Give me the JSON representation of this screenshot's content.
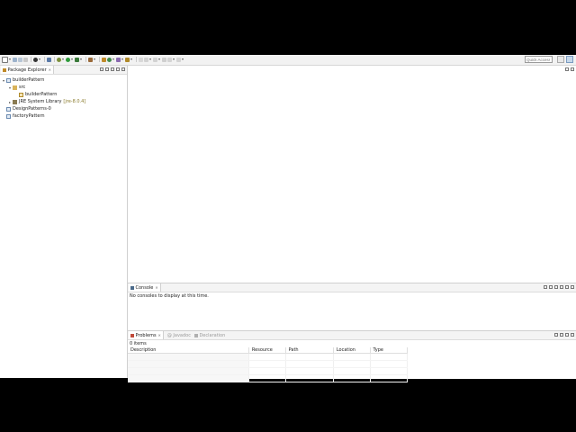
{
  "toolbar": {
    "quick_access_placeholder": "Quick Access",
    "icons": [
      "new-icon",
      "save-icon",
      "print-icon",
      "debug-icon",
      "run-icon",
      "external-tools-icon",
      "new-java-project-icon",
      "new-package-icon",
      "new-class-icon",
      "open-type-icon",
      "search-icon",
      "next-annotation-icon",
      "prev-annotation-icon",
      "back-icon",
      "forward-icon"
    ]
  },
  "package_explorer": {
    "tab_label": "Package Explorer",
    "tree": [
      {
        "label": "builderPattern",
        "level": 0,
        "expanded": true,
        "icon": "java-project-icon"
      },
      {
        "label": "src",
        "level": 1,
        "expanded": true,
        "icon": "source-folder-icon"
      },
      {
        "label": "builderPattern",
        "level": 2,
        "icon": "package-icon"
      },
      {
        "label": "JRE System Library",
        "suffix": "[jre-8.0.4]",
        "level": 1,
        "expanded": false,
        "icon": "library-icon"
      },
      {
        "label": "DesignPatterns-0",
        "level": 0,
        "icon": "java-project-icon"
      },
      {
        "label": "factoryPattern",
        "level": 0,
        "icon": "java-project-icon"
      }
    ]
  },
  "console": {
    "tab_label": "Console",
    "message": "No consoles to display at this time."
  },
  "problems": {
    "tabs": {
      "problems": "Problems",
      "javadoc": "Javadoc",
      "declaration": "Declaration"
    },
    "count": "0 items",
    "columns": [
      "Description",
      "Resource",
      "Path",
      "Location",
      "Type"
    ]
  },
  "colors": {
    "toolbar_bg": "#f2f2f2",
    "view_header_bg": "#f4f4f4",
    "jre_version": "#8a7b2c",
    "inactive_tab": "#9a9a9a"
  }
}
